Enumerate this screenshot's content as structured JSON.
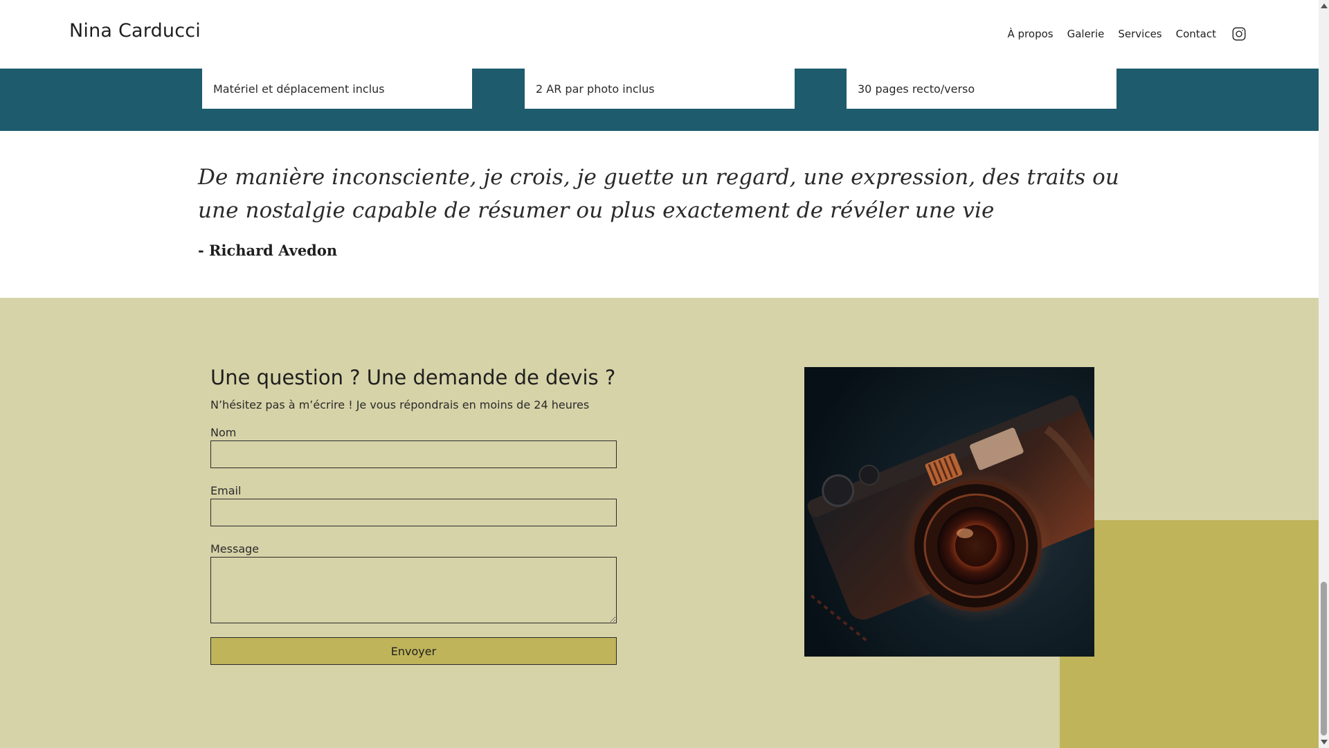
{
  "header": {
    "brand": "Nina Carducci",
    "nav": {
      "about": "À propos",
      "gallery": "Galerie",
      "services": "Services",
      "contact": "Contact"
    },
    "social_icon": "instagram-icon"
  },
  "features": [
    {
      "text": "Matériel et déplacement inclus"
    },
    {
      "text": "2 AR par photo inclus"
    },
    {
      "text": "30 pages recto/verso"
    }
  ],
  "quote": {
    "text": "De manière inconsciente, je crois, je guette un regard, une expression, des traits ou une nostalgie capable de résumer ou plus exactement de révéler une vie",
    "author": "- Richard Avedon"
  },
  "contact": {
    "title": "Une question ? Une demande de devis ?",
    "subtitle": "N’hésitez pas à m’écrire ! Je vous répondrais en moins de 24 heures",
    "fields": {
      "name_label": "Nom",
      "name_value": "",
      "email_label": "Email",
      "email_value": "",
      "message_label": "Message",
      "message_value": ""
    },
    "submit_label": "Envoyer",
    "image": "camera-photo"
  },
  "colors": {
    "teal": "#1d5b6d",
    "beige": "#d6d3a8",
    "olive": "#bfb45a"
  }
}
